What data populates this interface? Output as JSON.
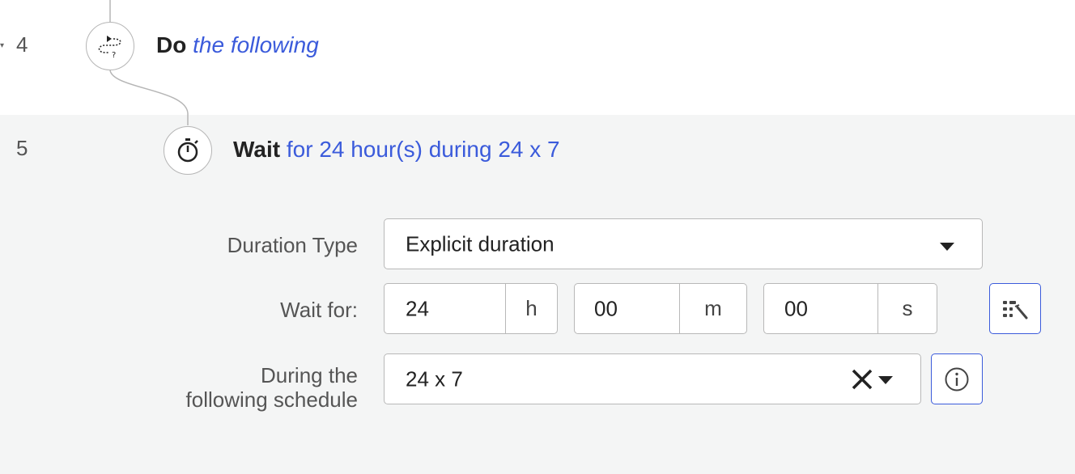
{
  "steps": [
    {
      "number": "4",
      "keyword": "Do",
      "description": "the following",
      "icon": "loop-route-icon"
    },
    {
      "number": "5",
      "keyword": "Wait",
      "description": "for 24 hour(s) during 24 x 7",
      "icon": "stopwatch-icon"
    }
  ],
  "form": {
    "duration_type": {
      "label": "Duration Type",
      "value": "Explicit duration"
    },
    "wait_for": {
      "label": "Wait for:",
      "hours": "24",
      "hours_unit": "h",
      "minutes": "00",
      "minutes_unit": "m",
      "seconds": "00",
      "seconds_unit": "s",
      "tool_icon": "expression-builder-icon"
    },
    "schedule": {
      "label_line1": "During the",
      "label_line2": "following schedule",
      "value": "24 x 7",
      "clear_icon": "close-icon",
      "info_icon": "info-icon"
    }
  },
  "colors": {
    "accent": "#3b5bdb",
    "selected_bg": "#f4f5f5",
    "border": "#b8b8b8"
  }
}
